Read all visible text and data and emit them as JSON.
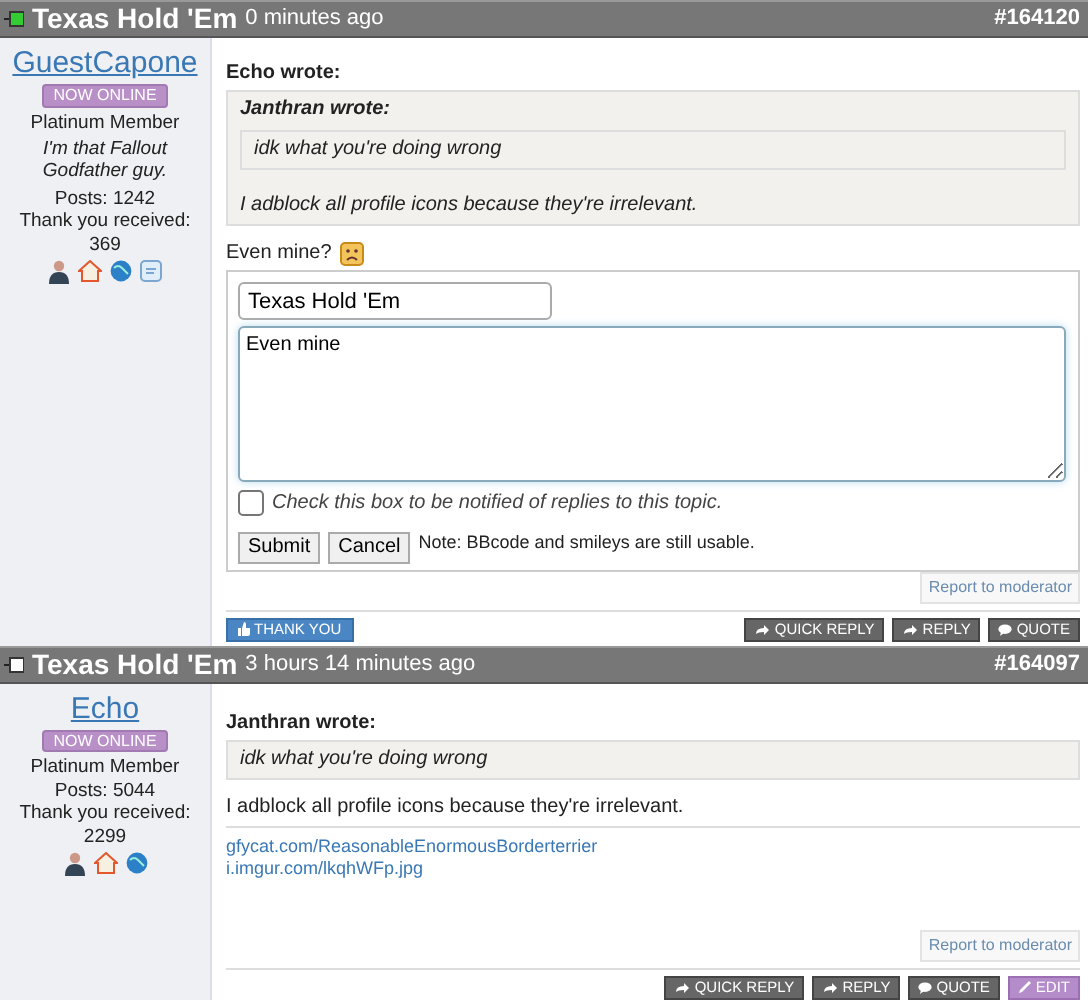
{
  "posts": [
    {
      "title": "Texas Hold 'Em",
      "time": "0 minutes ago",
      "number": "#164120",
      "is_new": true,
      "author": {
        "name": "GuestCapone",
        "badge": "NOW ONLINE",
        "rank": "Platinum Member",
        "signature": "I'm that Fallout Godfather guy.",
        "posts": "Posts: 1242",
        "thanks": "Thank you received: 369",
        "icons": [
          {
            "kind": "user"
          },
          {
            "kind": "home"
          },
          {
            "kind": "globe"
          },
          {
            "kind": "message"
          }
        ]
      },
      "content": [
        {
          "kind": "quote",
          "heading": "Echo wrote:",
          "children": [
            {
              "kind": "quote",
              "heading": "Janthran wrote:",
              "children": [
                {
                  "kind": "text",
                  "text": "idk what you're doing wrong"
                }
              ]
            },
            {
              "kind": "text",
              "text": "I adblock all profile icons because they're irrelevant."
            }
          ]
        },
        {
          "kind": "text",
          "text": "Even mine?",
          "smiley": true
        },
        {
          "kind": "form",
          "subject": "Texas Hold 'Em",
          "message": "Even mine",
          "notify_label": "Check this box to be notified of replies to this topic.",
          "notify_checked": false,
          "buttons": [
            "Submit",
            "Cancel"
          ],
          "note": "Note: BBcode and smileys are still usable."
        }
      ],
      "report": "Report to moderator",
      "thank": "THANK YOU",
      "actions": [
        {
          "kind": "reply",
          "label": "QUICK REPLY"
        },
        {
          "kind": "reply",
          "label": "REPLY"
        },
        {
          "kind": "quote",
          "label": "QUOTE"
        }
      ]
    },
    {
      "title": "Texas Hold 'Em",
      "time": "3 hours 14 minutes ago",
      "number": "#164097",
      "is_new": false,
      "author": {
        "name": "Echo",
        "badge": "NOW ONLINE",
        "rank": "Platinum Member",
        "posts": "Posts: 5044",
        "thanks": "Thank you received: 2299",
        "icons": [
          {
            "kind": "user"
          },
          {
            "kind": "home"
          },
          {
            "kind": "globe"
          }
        ]
      },
      "content": [
        {
          "kind": "quote",
          "heading": "Janthran wrote:",
          "children": [
            {
              "kind": "text",
              "text": "idk what you're doing wrong"
            }
          ]
        },
        {
          "kind": "text",
          "text": "I adblock all profile icons because they're irrelevant."
        },
        {
          "kind": "links",
          "items": [
            "gfycat.com/ReasonableEnormousBorderterrier",
            "i.imgur.com/lkqhWFp.jpg"
          ]
        }
      ],
      "report": "Report to moderator",
      "actions": [
        {
          "kind": "reply",
          "label": "QUICK REPLY"
        },
        {
          "kind": "reply",
          "label": "REPLY"
        },
        {
          "kind": "quote",
          "label": "QUOTE"
        },
        {
          "kind": "edit",
          "label": "EDIT"
        }
      ]
    }
  ]
}
